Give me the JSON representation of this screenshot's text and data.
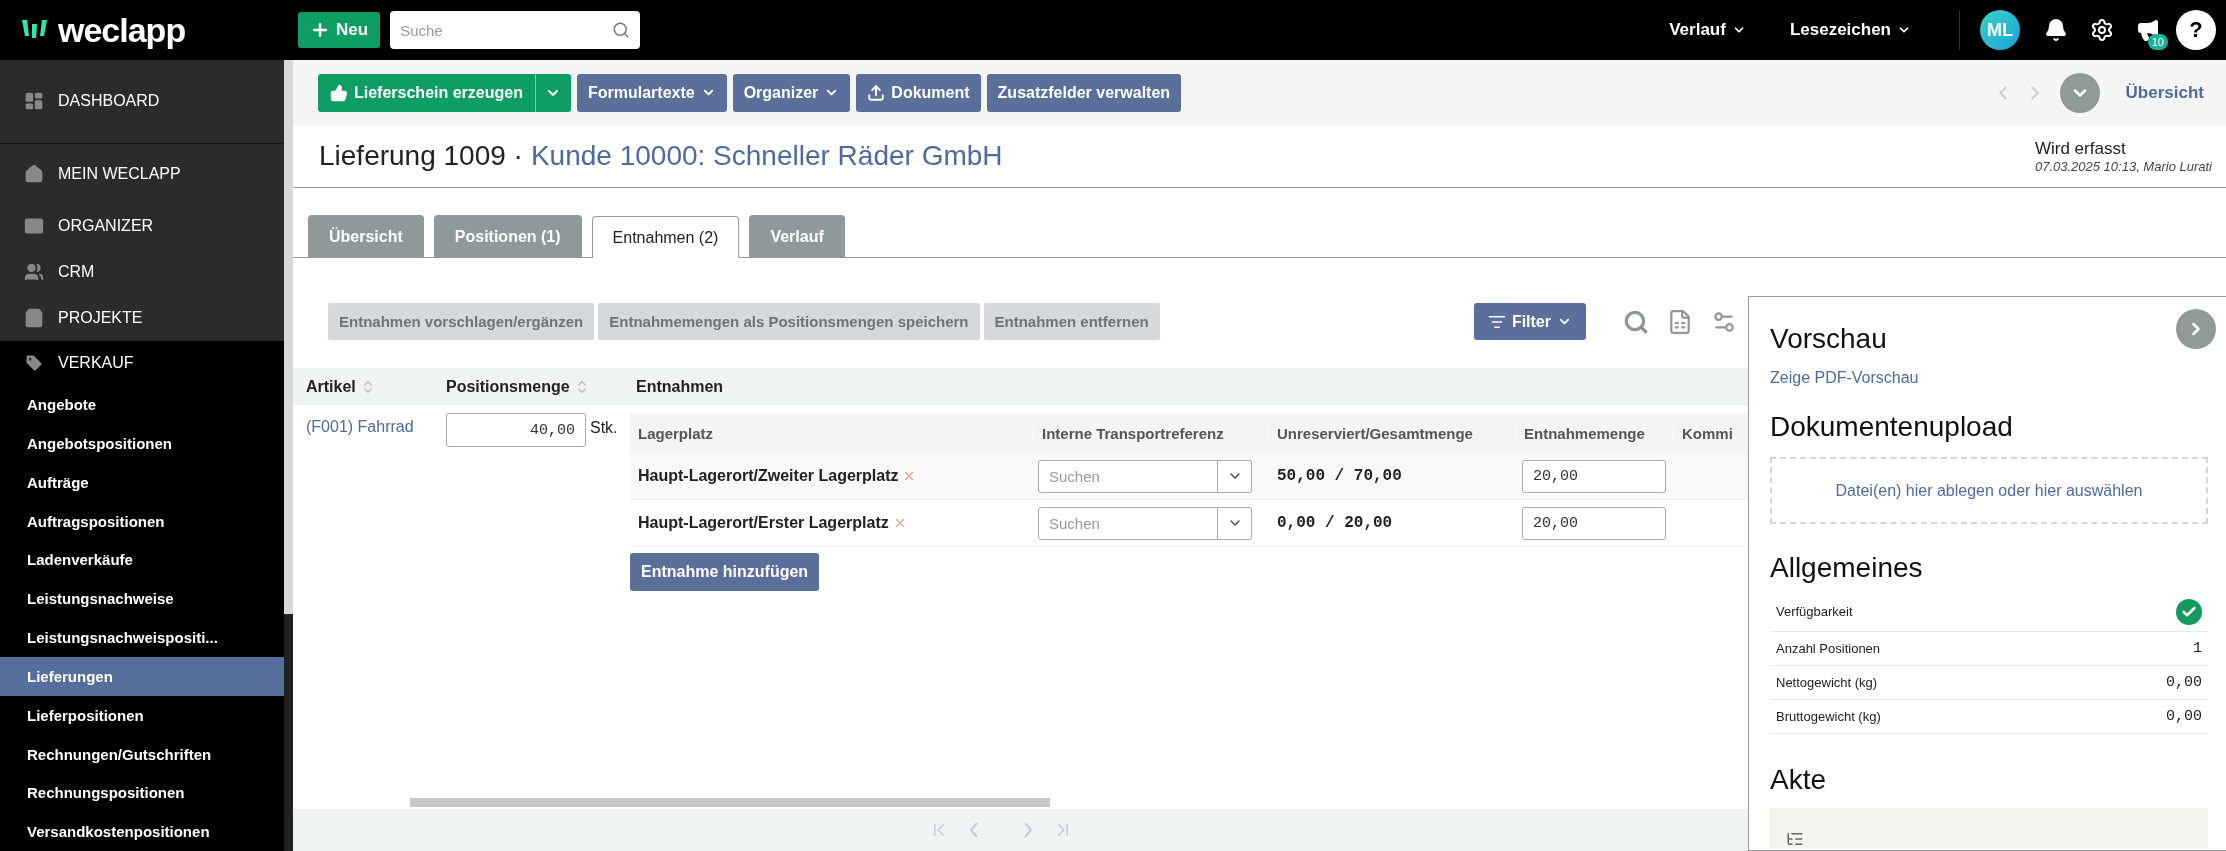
{
  "topbar": {
    "logo": "weclapp",
    "new_button": "Neu",
    "search": {
      "placeholder": "Suche"
    },
    "menus": [
      "Verlauf",
      "Lesezeichen"
    ],
    "avatar": "ML",
    "announcement_badge": "10",
    "help": "?"
  },
  "sidebar": {
    "modules": [
      {
        "label": "DASHBOARD"
      },
      {
        "label": "MEIN WECLAPP"
      },
      {
        "label": "ORGANIZER"
      },
      {
        "label": "CRM"
      },
      {
        "label": "PROJEKTE"
      }
    ],
    "active_module": {
      "label": "VERKAUF",
      "expanded": true,
      "items": [
        {
          "label": "Angebote",
          "selected": false
        },
        {
          "label": "Angebotspositionen",
          "selected": false
        },
        {
          "label": "Aufträge",
          "selected": false
        },
        {
          "label": "Auftragspositionen",
          "selected": false
        },
        {
          "label": "Ladenverkäufe",
          "selected": false
        },
        {
          "label": "Leistungsnachweise",
          "selected": false
        },
        {
          "label": "Leistungsnachweispositi...",
          "selected": false
        },
        {
          "label": "Lieferungen",
          "selected": true
        },
        {
          "label": "Lieferpositionen",
          "selected": false
        },
        {
          "label": "Rechnungen/Gutschriften",
          "selected": false
        },
        {
          "label": "Rechnungspositionen",
          "selected": false
        },
        {
          "label": "Versandkostenpositionen",
          "selected": false
        }
      ]
    }
  },
  "toolbar": {
    "primary_action": "Lieferschein erzeugen",
    "actions": [
      {
        "label": "Formulartexte",
        "kind": "dropdown"
      },
      {
        "label": "Organizer",
        "kind": "dropdown"
      },
      {
        "label": "Dokument",
        "kind": "upload"
      },
      {
        "label": "Zusatzfelder verwalten",
        "kind": "plain"
      }
    ],
    "overview_link": "Übersicht"
  },
  "header": {
    "title": "Lieferung 1009 ·",
    "customer_link": "Kunde 10000: Schneller Räder GmbH",
    "status": "Wird erfasst",
    "status_meta": "07.03.2025 10:13, Mario Lurati"
  },
  "tabs": [
    {
      "label": "Übersicht",
      "selected": false
    },
    {
      "label": "Positionen (1)",
      "selected": false
    },
    {
      "label": "Entnahmen (2)",
      "selected": true
    },
    {
      "label": "Verlauf",
      "selected": false
    }
  ],
  "grid": {
    "actions": [
      {
        "label": "Entnahmen vorschlagen/ergänzen",
        "disabled": true
      },
      {
        "label": "Entnahmemengen als Positionsmengen speichern",
        "disabled": true
      },
      {
        "label": "Entnahmen entfernen",
        "disabled": true
      }
    ],
    "filter": "Filter",
    "columns": [
      {
        "label": "Artikel",
        "sortable": true
      },
      {
        "label": "Positionsmenge",
        "sortable": true
      },
      {
        "label": "Entnahmen",
        "sortable": false
      }
    ],
    "rows": [
      {
        "article": "(F001) Fahrrad",
        "quantity": "40,00",
        "unit": "Stk.",
        "withdrawals": {
          "columns": [
            "Lagerplatz",
            "Interne Transportreferenz",
            "Unreserviert/Gesamtmenge",
            "Entnahmemenge",
            "Kommi"
          ],
          "rows": [
            {
              "location": "Haupt-Lagerort/Zweiter Lagerplatz",
              "transport_placeholder": "Suchen",
              "stock": "50,00 / 70,00",
              "amount": "20,00"
            },
            {
              "location": "Haupt-Lagerort/Erster Lagerplatz",
              "transport_placeholder": "Suchen",
              "stock": "0,00 / 20,00",
              "amount": "20,00"
            }
          ],
          "add_button": "Entnahme hinzufügen"
        }
      }
    ]
  },
  "panel": {
    "preview_heading": "Vorschau",
    "preview_link": "Zeige PDF-Vorschau",
    "upload_heading": "Dokumentenupload",
    "dropzone": "Datei(en) hier ablegen oder hier auswählen",
    "general_heading": "Allgemeines",
    "general_rows": [
      {
        "label": "Verfügbarkeit",
        "kind": "status",
        "checked": true
      },
      {
        "label": "Anzahl Positionen",
        "kind": "value",
        "value": "1"
      },
      {
        "label": "Nettogewicht (kg)",
        "kind": "value",
        "value": "0,00"
      },
      {
        "label": "Bruttogewicht (kg)",
        "kind": "value",
        "value": "0,00"
      }
    ],
    "file_heading": "Akte"
  }
}
